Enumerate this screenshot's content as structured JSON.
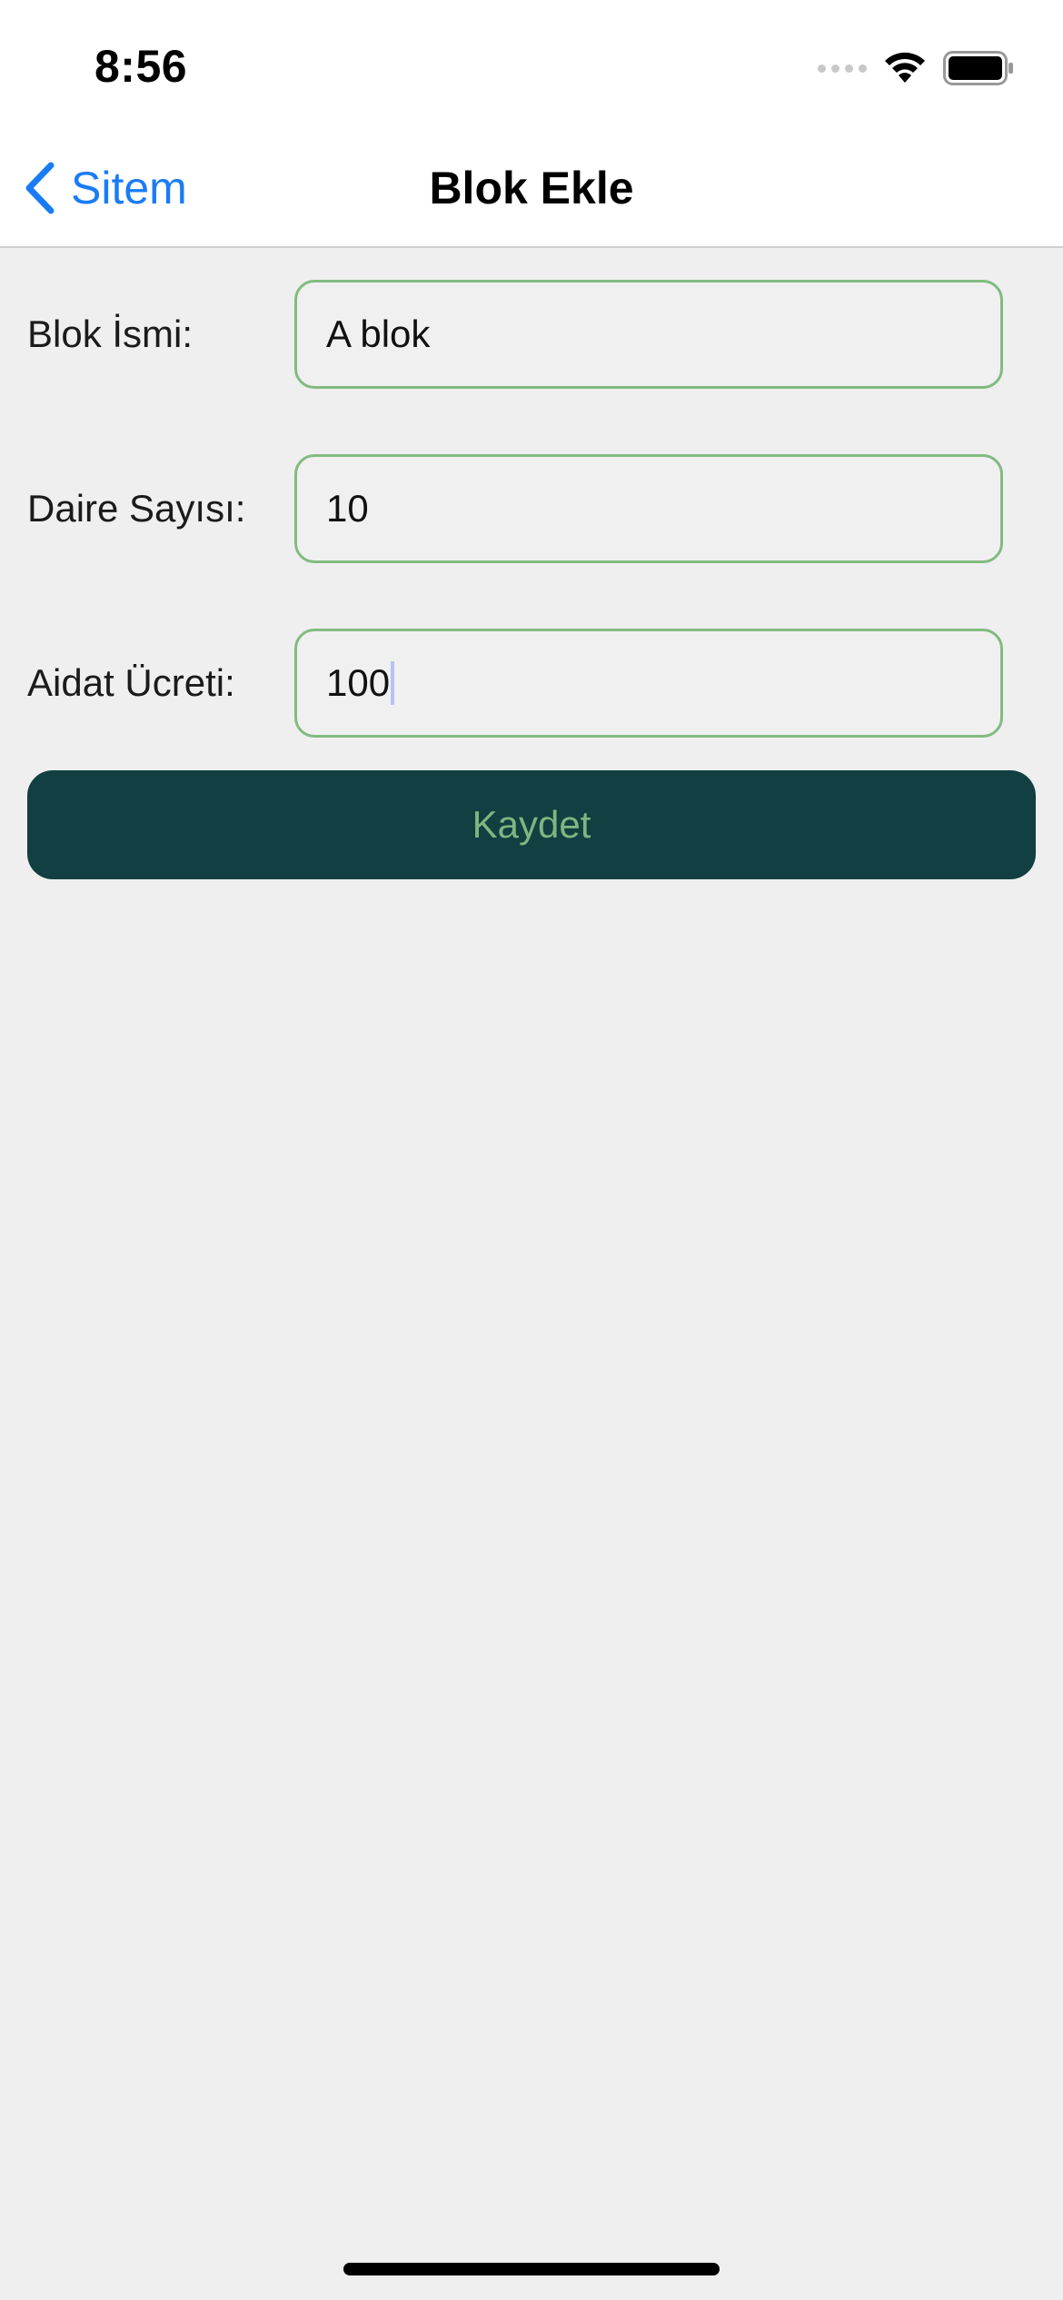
{
  "status_bar": {
    "time": "8:56",
    "icons": [
      "cellular-signal-icon",
      "wifi-icon",
      "battery-icon"
    ]
  },
  "nav": {
    "back_label": "Sitem",
    "back_icon": "chevron-left-icon",
    "title": "Blok Ekle"
  },
  "form": {
    "fields": [
      {
        "label": "Blok İsmi:",
        "value": "A blok"
      },
      {
        "label": "Daire Sayısı:",
        "value": "10"
      },
      {
        "label": "Aidat Ücreti:",
        "value": "100"
      }
    ],
    "save_label": "Kaydet"
  },
  "colors": {
    "accent": "#1a7cf5",
    "input_border": "#82bb80",
    "button_bg": "#123f41",
    "button_text": "#7eb681",
    "background": "#efefef"
  }
}
